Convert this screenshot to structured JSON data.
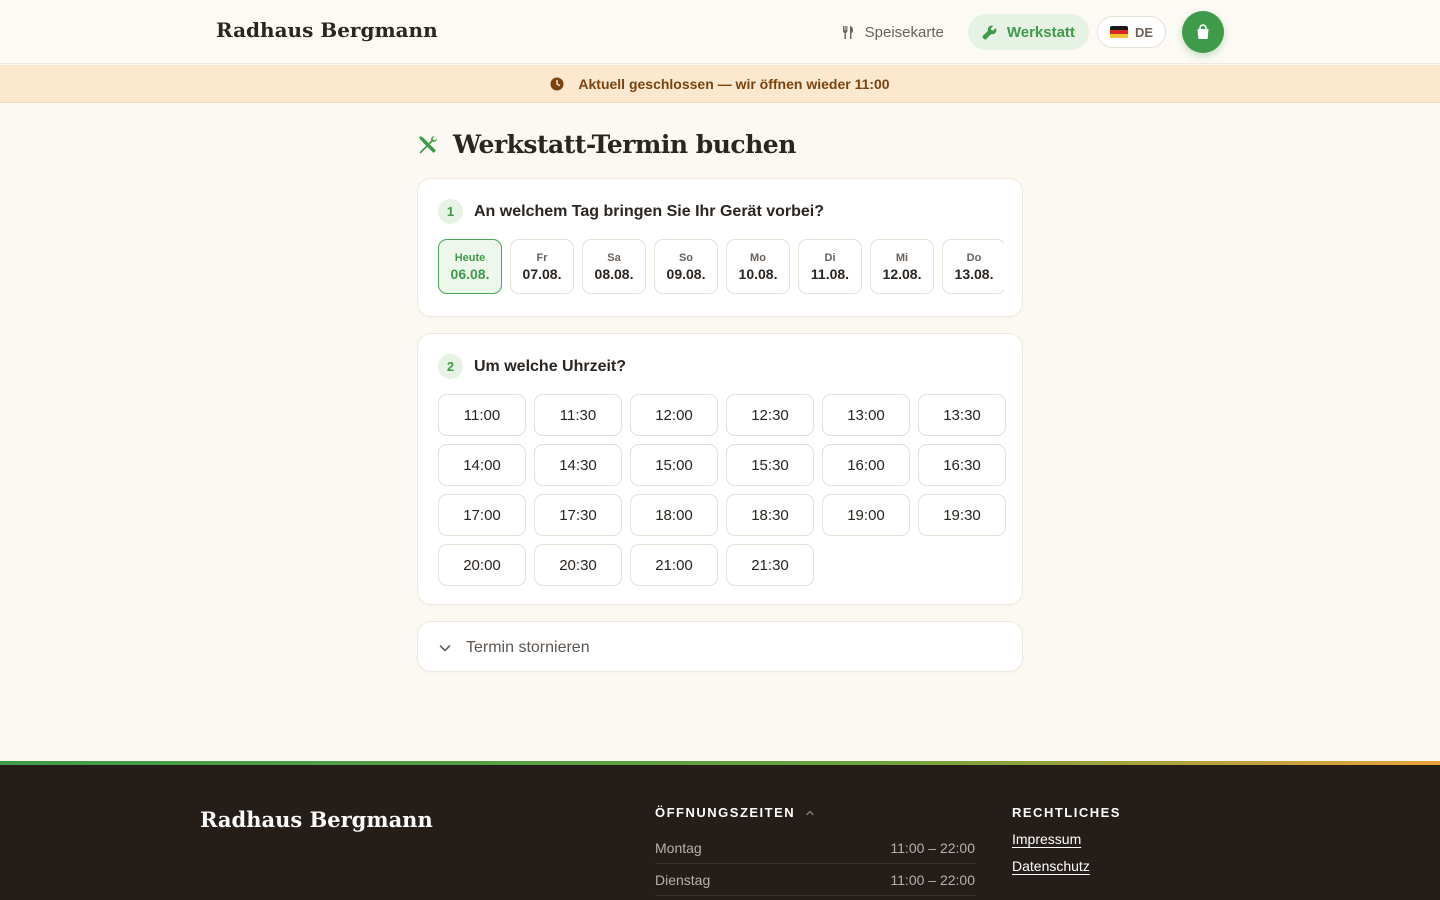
{
  "header": {
    "brand": "Radhaus Bergmann",
    "nav": {
      "menu_label": "Speisekarte",
      "workshop_label": "Werkstatt"
    },
    "language": "DE"
  },
  "banner": {
    "text": "Aktuell geschlossen — wir öffnen wieder 11:00"
  },
  "page": {
    "title": "Werkstatt-Termin buchen"
  },
  "step1": {
    "number": "1",
    "label": "An welchem Tag bringen Sie Ihr Gerät vorbei?",
    "days": [
      {
        "name": "Heute",
        "date": "06.08."
      },
      {
        "name": "Fr",
        "date": "07.08."
      },
      {
        "name": "Sa",
        "date": "08.08."
      },
      {
        "name": "So",
        "date": "09.08."
      },
      {
        "name": "Mo",
        "date": "10.08."
      },
      {
        "name": "Di",
        "date": "11.08."
      },
      {
        "name": "Mi",
        "date": "12.08."
      },
      {
        "name": "Do",
        "date": "13.08."
      }
    ]
  },
  "step2": {
    "number": "2",
    "label": "Um welche Uhrzeit?",
    "slots": [
      "11:00",
      "11:30",
      "12:00",
      "12:30",
      "13:00",
      "13:30",
      "14:00",
      "14:30",
      "15:00",
      "15:30",
      "16:00",
      "16:30",
      "17:00",
      "17:30",
      "18:00",
      "18:30",
      "19:00",
      "19:30",
      "20:00",
      "20:30",
      "21:00",
      "21:30"
    ]
  },
  "cancel": {
    "label": "Termin stornieren"
  },
  "footer": {
    "brand": "Radhaus Bergmann",
    "hours_heading": "ÖFFNUNGSZEITEN",
    "hours": [
      {
        "day": "Montag",
        "time": "11:00 – 22:00"
      },
      {
        "day": "Dienstag",
        "time": "11:00 – 22:00"
      }
    ],
    "legal_heading": "RECHTLICHES",
    "legal_links": [
      "Impressum",
      "Datenschutz"
    ]
  },
  "colors": {
    "accent": "#3f9a4a",
    "banner_bg": "#fbe8cf",
    "banner_text": "#7a4310",
    "footer_bg": "#241d18"
  }
}
